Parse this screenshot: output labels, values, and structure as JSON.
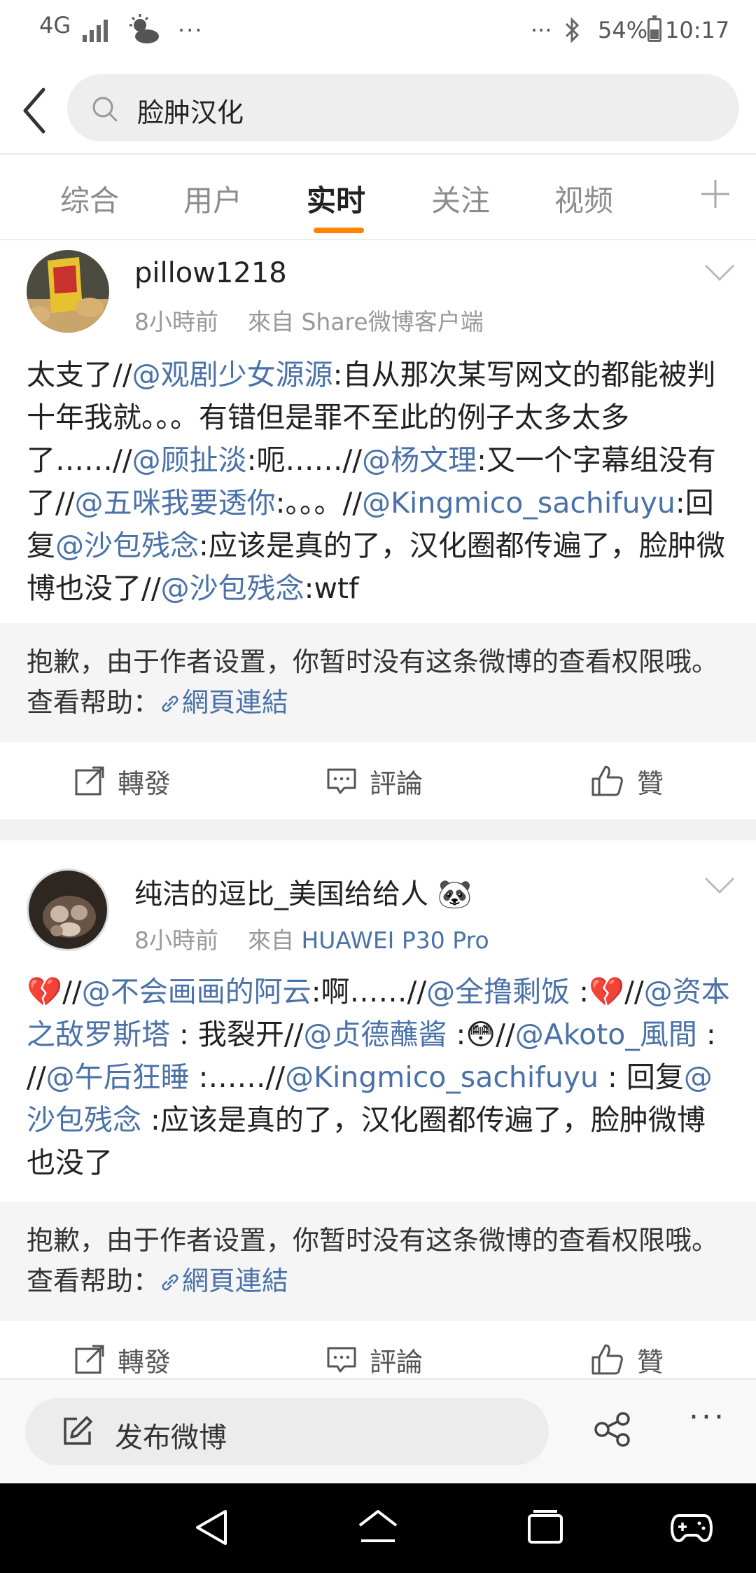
{
  "status_bar": {
    "network": "4G",
    "left_more": "···",
    "right_more": "···",
    "battery": "54%",
    "battery_level": 0.54,
    "time": "10:17"
  },
  "search": {
    "query": "脸肿汉化"
  },
  "tabs": [
    {
      "label": "综合",
      "active": false
    },
    {
      "label": "用户",
      "active": false
    },
    {
      "label": "实时",
      "active": true
    },
    {
      "label": "关注",
      "active": false
    },
    {
      "label": "视频",
      "active": false
    }
  ],
  "posts": [
    {
      "username": "pillow1218",
      "time": "8小時前",
      "source_prefix": "來自",
      "source": "Share微博客户端",
      "body": [
        {
          "t": "太支了//"
        },
        {
          "t": "@观剧少女源源",
          "m": true
        },
        {
          "t": ":自从那次某写网文的都能被判十年我就。。。有错但是罪不至此的例子太多太多了……//"
        },
        {
          "t": "@顾扯淡",
          "m": true
        },
        {
          "t": ":呃……//"
        },
        {
          "t": "@杨文理",
          "m": true
        },
        {
          "t": ":又一个字幕组没有了//"
        },
        {
          "t": "@五咪我要透你",
          "m": true
        },
        {
          "t": ":。。。//"
        },
        {
          "t": "@Kingmico_sachifuyu",
          "m": true
        },
        {
          "t": ":回复"
        },
        {
          "t": "@沙包残念",
          "m": true
        },
        {
          "t": ":应该是真的了，汉化圈都传遍了，脸肿微博也没了//"
        },
        {
          "t": "@沙包残念",
          "m": true
        },
        {
          "t": ":wtf"
        }
      ],
      "notice": "抱歉，由于作者设置，你暂时没有这条微博的查看权限哦。查看帮助：",
      "notice_link": "網頁連結",
      "actions": {
        "repost": "轉發",
        "comment": "評論",
        "like": "贊"
      }
    },
    {
      "username": "纯洁的逗比_美国给给人",
      "username_emoji": "🐼",
      "time": "8小時前",
      "source_prefix": "來自",
      "source": "HUAWEI P30 Pro",
      "body": [
        {
          "t": "💔",
          "e": true
        },
        {
          "t": "//"
        },
        {
          "t": "@不会画画的阿云",
          "m": true
        },
        {
          "t": ":啊……//"
        },
        {
          "t": "@全撸剩饭",
          "m": true
        },
        {
          "t": " :"
        },
        {
          "t": "💔",
          "e": true
        },
        {
          "t": "//"
        },
        {
          "t": "@资本之敌罗斯塔",
          "m": true
        },
        {
          "t": " : 我裂开//"
        },
        {
          "t": "@贞德蘸酱",
          "m": true
        },
        {
          "t": " :"
        },
        {
          "t": "😳",
          "e": true
        },
        {
          "t": "//"
        },
        {
          "t": "@Akoto_風間",
          "m": true
        },
        {
          "t": " : //"
        },
        {
          "t": "@午后狂睡",
          "m": true
        },
        {
          "t": " :……//"
        },
        {
          "t": "@Kingmico_sachifuyu",
          "m": true
        },
        {
          "t": " : 回复"
        },
        {
          "t": "@沙包残念",
          "m": true
        },
        {
          "t": " :应该是真的了，汉化圈都传遍了，脸肿微博也没了"
        }
      ],
      "notice": "抱歉，由于作者设置，你暂时没有这条微博的查看权限哦。查看帮助：",
      "notice_link": "網頁連結",
      "actions": {
        "repost": "轉發",
        "comment": "評論",
        "like": "贊"
      }
    }
  ],
  "compose": {
    "label": "发布微博"
  },
  "bottom_more": "···",
  "colors": {
    "accent": "#ff8200",
    "link": "#4a72a8"
  },
  "icons": [
    "back-icon",
    "search-icon",
    "add-tab-icon",
    "chevron-down-icon",
    "repost-icon",
    "comment-icon",
    "like-icon",
    "edit-icon",
    "share-icon",
    "nav-back-icon",
    "nav-home-icon",
    "nav-recents-icon",
    "game-icon"
  ]
}
